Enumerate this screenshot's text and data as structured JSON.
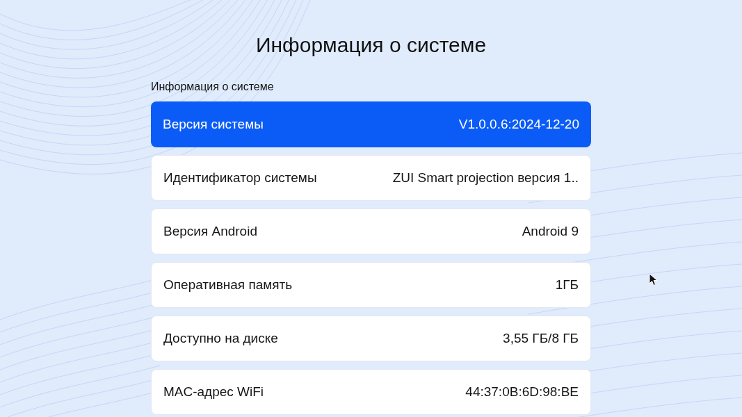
{
  "title": "Информация о системе",
  "section_label": "Информация о системе",
  "rows": [
    {
      "label": "Версия системы",
      "value": "V1.0.0.6:2024-12-20",
      "selected": true
    },
    {
      "label": "Идентификатор системы",
      "value": "ZUI Smart projection версия 1..",
      "selected": false
    },
    {
      "label": "Версия Android",
      "value": "Android 9",
      "selected": false
    },
    {
      "label": "Оперативная память",
      "value": "1ГБ",
      "selected": false
    },
    {
      "label": "Доступно на диске",
      "value": "3,55 ГБ/8 ГБ",
      "selected": false
    },
    {
      "label": "MAC-адрес WiFi",
      "value": "44:37:0B:6D:98:BE",
      "selected": false
    }
  ]
}
